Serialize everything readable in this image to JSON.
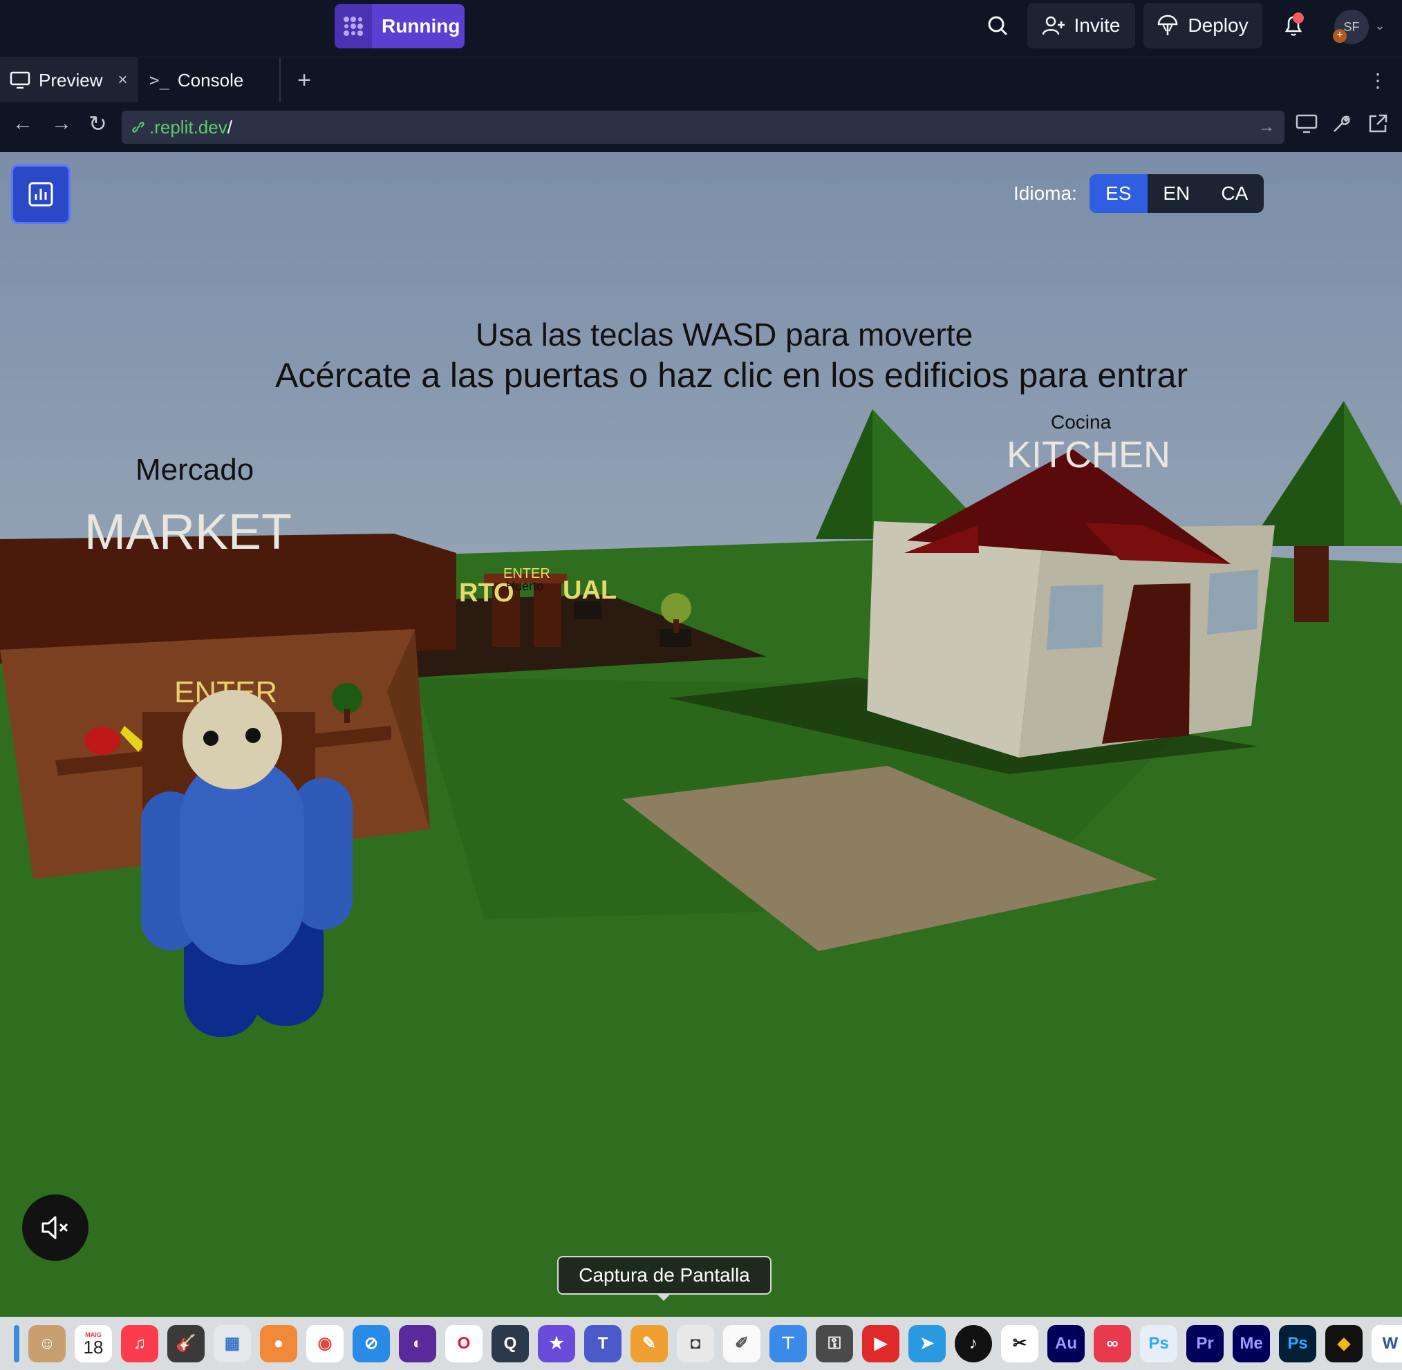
{
  "topbar": {
    "run_label": "Running",
    "invite_label": "Invite",
    "deploy_label": "Deploy",
    "avatar_initials": "SF"
  },
  "tabs": {
    "preview_label": "Preview",
    "console_label": "Console"
  },
  "url": {
    "host": ".replit.dev",
    "path": "/"
  },
  "game": {
    "language_label": "Idioma:",
    "languages": [
      "ES",
      "EN",
      "CA"
    ],
    "active_language": "ES",
    "instruction_line1": "Usa las teclas WASD para moverte",
    "instruction_line2": "Acércate a las puertas o haz clic en los edificios para entrar",
    "market_label_es": "Mercado",
    "market_label": "MARKET",
    "market_enter": "ENTER",
    "garden_enter": "ENTER",
    "garden_label_es": "Huerto",
    "garden_sign_left": "RTO",
    "garden_sign_right": "UAL",
    "kitchen_label_es": "Cocina",
    "kitchen_label": "KITCHEN"
  },
  "tooltip": "Captura de Pantalla",
  "dock": {
    "calendar_month": "MAIG",
    "calendar_day": "18",
    "apps": [
      "finder",
      "contacts",
      "calendar",
      "music",
      "garageband",
      "preview",
      "facetime",
      "chrome",
      "safari",
      "tor",
      "opera",
      "quicktime",
      "imovie",
      "teams",
      "pages",
      "screenshot",
      "textedit",
      "keynote",
      "keychain",
      "pdf",
      "telegram",
      "tiktok",
      "capcut",
      "audition",
      "creative-cloud",
      "photoshop",
      "premiere",
      "media-encoder",
      "photoshop",
      "binance",
      "word",
      "c-app"
    ]
  },
  "colors": {
    "accent": "#5b3fd0",
    "lang_active": "#2f5fe0",
    "grass": "#2f6e1e",
    "url_green": "#5fc96d"
  }
}
